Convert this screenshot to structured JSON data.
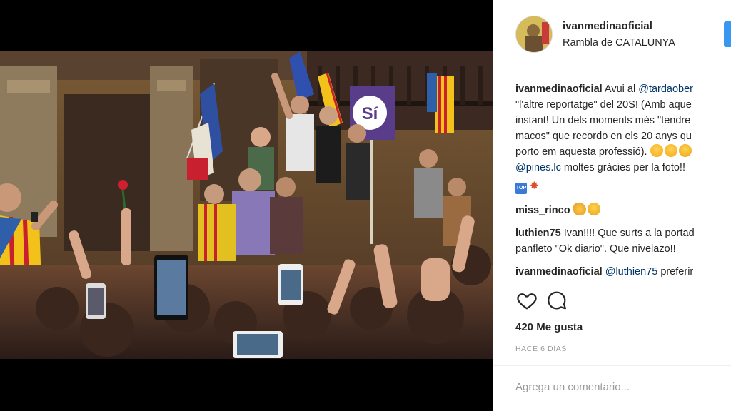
{
  "header": {
    "username": "ivanmedinaoficial",
    "location": "Rambla de CATALUNYA"
  },
  "photo": {
    "sign_text": "Sí",
    "colors": {
      "sign": "#5a3d8a",
      "flag_yellow": "#f2c21b",
      "flag_red": "#c8202f",
      "estelada_blue": "#2f5fa8"
    }
  },
  "caption": {
    "username": "ivanmedinaoficial",
    "line1_before": "Avui al ",
    "line1_mention": "@tardaober",
    "line2": "\"l'altre reportatge\" del 20S! (Amb aque",
    "line3": "instant! Un dels moments més \"tendre",
    "line4": "macos\" que recordo en els 20 anys qu",
    "line5": "porto em aquesta professió).",
    "line6_mention": "@pines.lc",
    "line6_text": " moltes gràcies per la foto!! ",
    "top_icon_text": "TOP"
  },
  "comments": [
    {
      "username": "miss_rinco",
      "text": ""
    },
    {
      "username": "luthien75",
      "text": "Ivan!!!! Que surts a la portad",
      "text2": "panfleto \"Ok diario\". Que nivelazo!!"
    },
    {
      "username": "ivanmedinaoficial",
      "mention": "@luthien75",
      "text": " preferir"
    }
  ],
  "actions": {
    "like_icon": "heart-icon",
    "comment_icon": "speech-bubble-icon"
  },
  "likes_text": "420 Me gusta",
  "timestamp": "HACE 6 DÍAS",
  "add_comment": {
    "placeholder": "Agrega un comentario...",
    "value": ""
  },
  "colors": {
    "link": "#003569",
    "muted": "#999999",
    "text": "#262626",
    "follow": "#3897f0"
  }
}
